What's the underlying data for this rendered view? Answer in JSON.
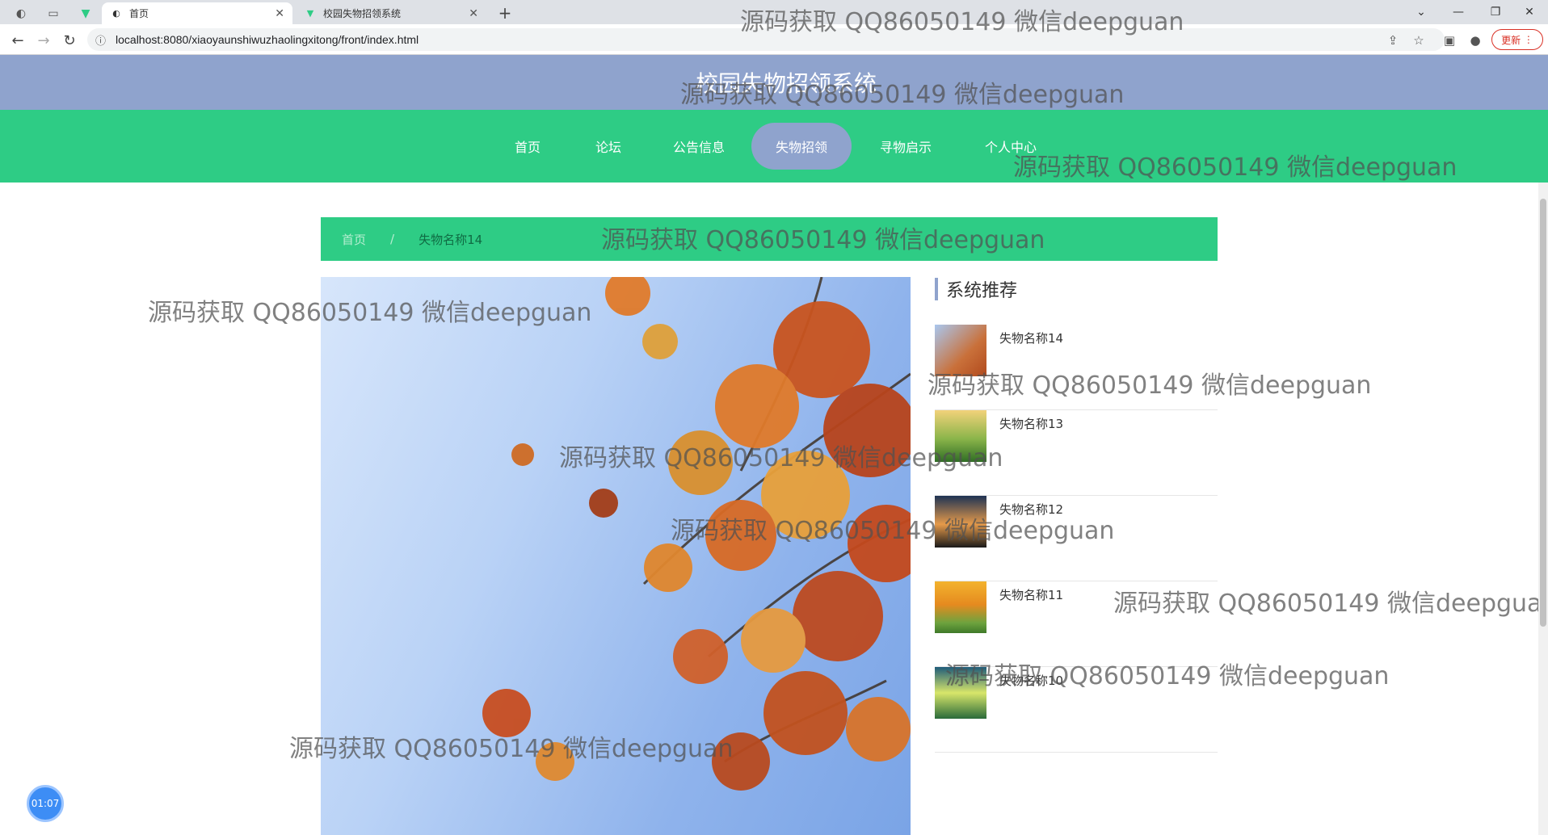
{
  "browser": {
    "tabs": [
      {
        "title": "首页",
        "active": true
      },
      {
        "title": "校园失物招领系统",
        "active": false
      }
    ],
    "url": "localhost:8080/xiaoyaunshiwuzhaolingxitong/front/index.html",
    "update_label": "更新"
  },
  "site": {
    "title": "校园失物招领系统",
    "nav": [
      "首页",
      "论坛",
      "公告信息",
      "失物招领",
      "寻物启示",
      "个人中心"
    ],
    "active_nav": "失物招领"
  },
  "breadcrumb": {
    "home": "首页",
    "separator": "/",
    "current": "失物名称14"
  },
  "recommend": {
    "title": "系统推荐",
    "items": [
      {
        "name": "失物名称14"
      },
      {
        "name": "失物名称13"
      },
      {
        "name": "失物名称12"
      },
      {
        "name": "失物名称11"
      },
      {
        "name": "失物名称10"
      }
    ]
  },
  "watermark": "源码获取 QQ86050149 微信deepguan",
  "timer": "01:07",
  "colors": {
    "header": "#8fa3cd",
    "navbar": "#2ecc85",
    "accent": "#8fa3cd"
  }
}
